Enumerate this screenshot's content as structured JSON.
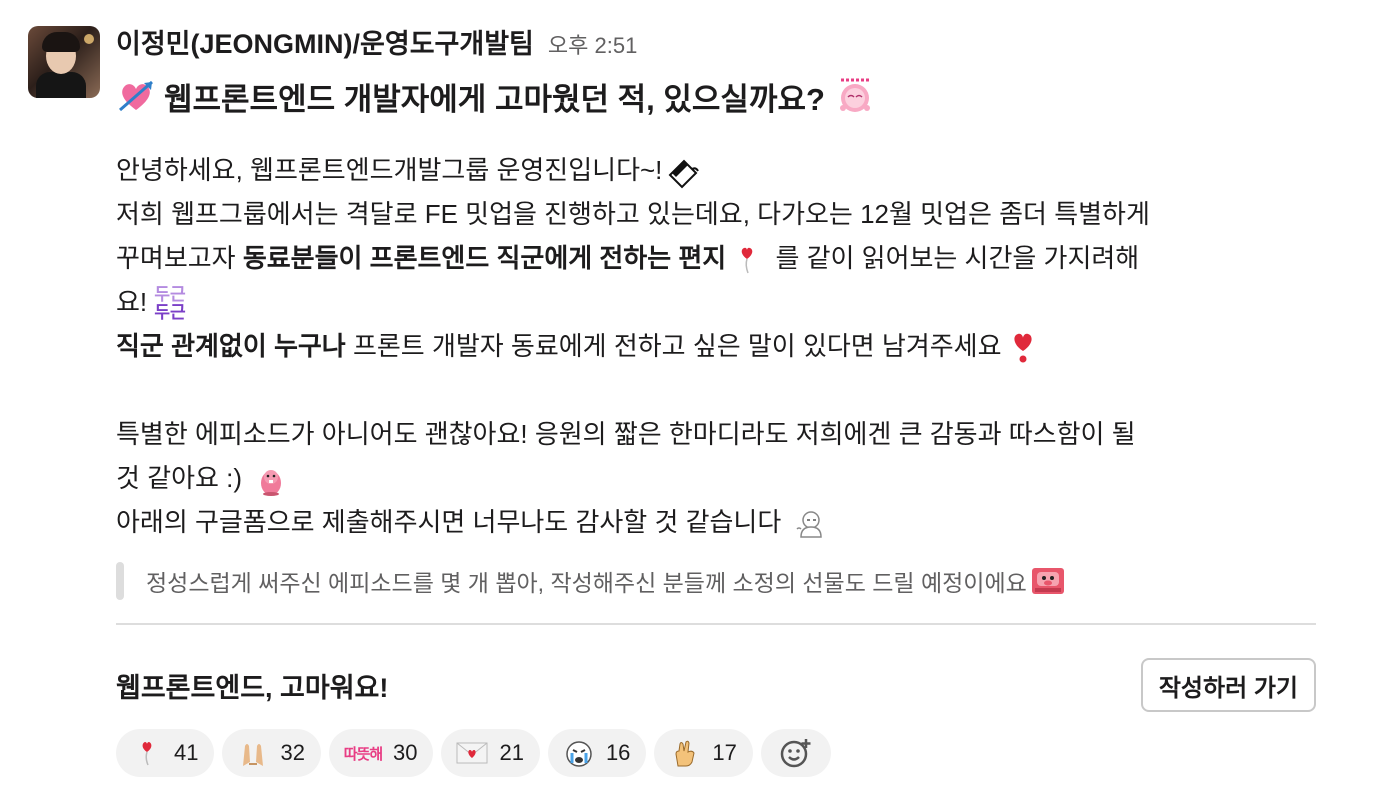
{
  "message": {
    "sender": "이정민(JEONGMIN)/운영도구개발팀",
    "timestamp": "오후 2:51",
    "title": "웹프론트엔드 개발자에게 고마웠던 적, 있으실까요?",
    "line1": "안녕하세요, 웹프론트엔드개발그룹 운영진입니다~!",
    "line2": "저희 웹프그룹에서는 격달로 FE 밋업을 진행하고 있는데요, 다가오는 12월 밋업은 좀더 특별하게",
    "line3_pre": "꾸며보고자 ",
    "line3_bold": "동료분들이 프론트엔드 직군에게 전하는 편지",
    "line3_post": " 를 같이 읽어보는 시간을 가지려해",
    "line4": "요!",
    "line5_bold": "직군 관계없이 누구나",
    "line5_post": " 프론트 개발자 동료에게 전하고 싶은 말이 있다면 남겨주세요",
    "line6": "특별한 에피소드가 아니어도 괜찮아요! 응원의 짧은 한마디라도 저희에겐 큰 감동과 따스함이 될",
    "line7": "것 같아요 :)",
    "line8": "아래의 구글폼으로 제출해주시면 너무나도 감사할 것 같습니다",
    "quote": "정성스럽게 써주신 에피소드를 몇 개 뽑아, 작성해주신 분들께 소정의 선물도 드릴 예정이에요",
    "dugeun_emoji_text": "두근",
    "cta_title": "웹프론트엔드, 고마워요!",
    "cta_button": "작성하러 가기"
  },
  "reactions": [
    {
      "icon": "balloon-heart-icon",
      "count": "41"
    },
    {
      "icon": "folded-hands-icon",
      "count": "32"
    },
    {
      "icon": "ttatteuthae-text-emoji-icon",
      "label": "따뜻해",
      "count": "30"
    },
    {
      "icon": "love-letter-icon",
      "count": "21"
    },
    {
      "icon": "crying-face-icon",
      "count": "16"
    },
    {
      "icon": "hand-sign-icon",
      "count": "17"
    }
  ],
  "colors": {
    "accent_pink": "#e83d84",
    "heart_red": "#e0293b",
    "purple": "#7b3fc7",
    "muted_text": "#616061"
  }
}
